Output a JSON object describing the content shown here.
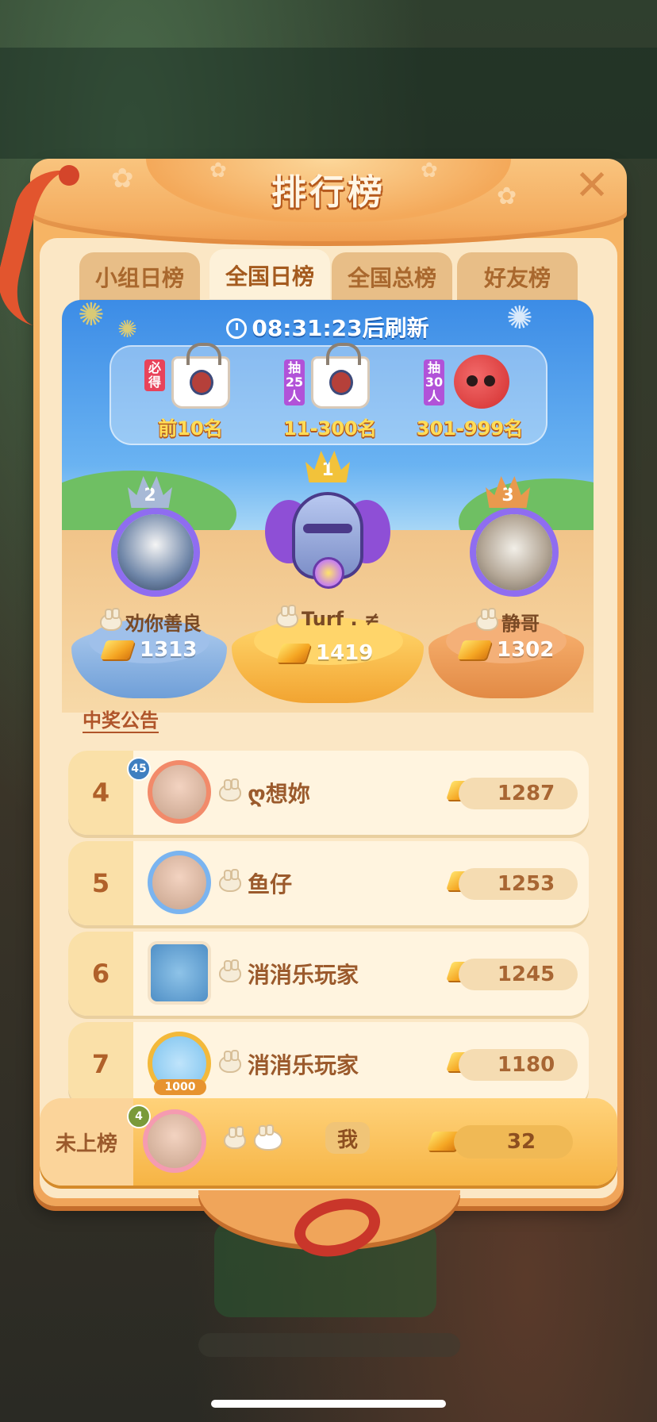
{
  "title": "排行榜",
  "tabs": [
    {
      "label": "小组日榜",
      "active": false
    },
    {
      "label": "全国日榜",
      "active": true
    },
    {
      "label": "全国总榜",
      "active": false
    },
    {
      "label": "好友榜",
      "active": false
    }
  ],
  "refresh_timer": "08:31:23后刷新",
  "prizes": [
    {
      "tag": "必得",
      "range": "前10名",
      "tag_color": "#e8435a",
      "item": "bag"
    },
    {
      "tag": "抽25人",
      "tag_lines": [
        "抽",
        "25",
        "人"
      ],
      "range": "11-300名",
      "tag_color": "#b152d8",
      "item": "bag"
    },
    {
      "tag": "抽30人",
      "tag_lines": [
        "抽",
        "30",
        "人"
      ],
      "range": "301-999名",
      "tag_color": "#b152d8",
      "item": "fox-plush"
    }
  ],
  "podium": {
    "first": {
      "rank": "1",
      "name": "Turf . ≠",
      "score": "1419"
    },
    "second": {
      "rank": "2",
      "name": "劝你善良",
      "score": "1313"
    },
    "third": {
      "rank": "3",
      "name": "静哥",
      "score": "1302"
    }
  },
  "notice_link": "中奖公告",
  "leaderboard": [
    {
      "rank": "4",
      "name": "ღ想妳",
      "score": "1287",
      "level": "45"
    },
    {
      "rank": "5",
      "name": "鱼仔",
      "score": "1253"
    },
    {
      "rank": "6",
      "name": "消消乐玩家",
      "score": "1245"
    },
    {
      "rank": "7",
      "name": "消消乐玩家",
      "score": "1180",
      "avatar_label": "1000"
    }
  ],
  "self": {
    "rank_label": "未上榜",
    "name": "我",
    "score": "32",
    "level": "4"
  },
  "colors": {
    "frame": "#f0a55a",
    "panel": "#fbe7c5",
    "gold_pedestal": "#f2a431",
    "silver_pedestal": "#6f9fd8",
    "bronze_pedestal": "#e28a45",
    "text_brown": "#9b5a2c"
  },
  "icons": [
    "close-icon",
    "clock-icon",
    "crown-icon",
    "gold-bar-icon",
    "bunny-icon"
  ]
}
